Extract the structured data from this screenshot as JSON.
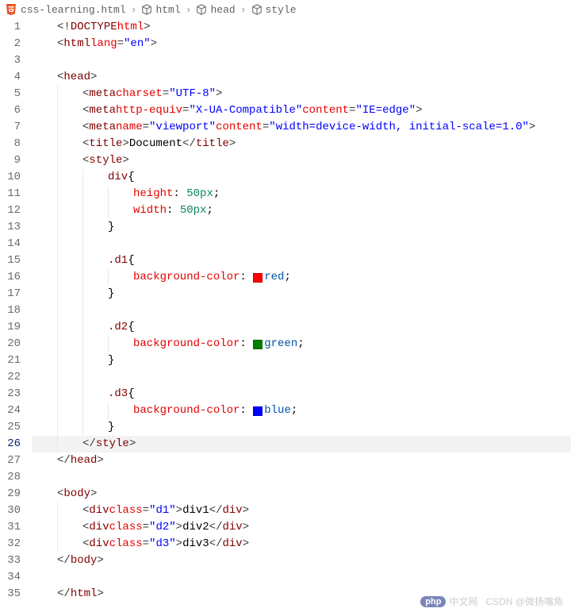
{
  "breadcrumb": {
    "file": "css-learning.html",
    "path": [
      "html",
      "head",
      "style"
    ]
  },
  "lines": {
    "start": 1,
    "end": 35,
    "active": 26
  },
  "code": {
    "l1_doctype": "<!DOCTYPE html>",
    "l2": {
      "tag": "html",
      "attr": "lang",
      "val": "\"en\""
    },
    "l4": {
      "tag": "head"
    },
    "l5": {
      "tag": "meta",
      "attr": "charset",
      "val": "\"UTF-8\""
    },
    "l6": {
      "tag": "meta",
      "a1": "http-equiv",
      "v1": "\"X-UA-Compatible\"",
      "a2": "content",
      "v2": "\"IE=edge\""
    },
    "l7": {
      "tag": "meta",
      "a1": "name",
      "v1": "\"viewport\"",
      "a2": "content",
      "v2": "\"width=device-width, initial-scale=1.0\""
    },
    "l8": {
      "tag": "title",
      "text": "Document"
    },
    "l9": {
      "tag": "style"
    },
    "l10": {
      "sel": "div",
      "brace": "{"
    },
    "l11": {
      "prop": "height",
      "val": "50px"
    },
    "l12": {
      "prop": "width",
      "val": "50px"
    },
    "l13": {
      "brace": "}"
    },
    "l15": {
      "sel": ".d1",
      "brace": "{"
    },
    "l16": {
      "prop": "background-color",
      "val": "red",
      "swatch": "#ff0000"
    },
    "l17": {
      "brace": "}"
    },
    "l19": {
      "sel": ".d2",
      "brace": "{"
    },
    "l20": {
      "prop": "background-color",
      "val": "green",
      "swatch": "#008000"
    },
    "l21": {
      "brace": "}"
    },
    "l23": {
      "sel": ".d3",
      "brace": "{"
    },
    "l24": {
      "prop": "background-color",
      "val": "blue",
      "swatch": "#0000ff"
    },
    "l25": {
      "brace": "}"
    },
    "l26": {
      "tag": "style"
    },
    "l27": {
      "tag": "head"
    },
    "l29": {
      "tag": "body"
    },
    "l30": {
      "tag": "div",
      "attr": "class",
      "val": "\"d1\"",
      "text": "div1"
    },
    "l31": {
      "tag": "div",
      "attr": "class",
      "val": "\"d2\"",
      "text": "div2"
    },
    "l32": {
      "tag": "div",
      "attr": "class",
      "val": "\"d3\"",
      "text": "div3"
    },
    "l33": {
      "tag": "body"
    },
    "l35": {
      "tag": "html"
    }
  },
  "watermark": {
    "badge": "php",
    "text1": "中文网",
    "text2": "CSDN @微扬嘴角"
  }
}
